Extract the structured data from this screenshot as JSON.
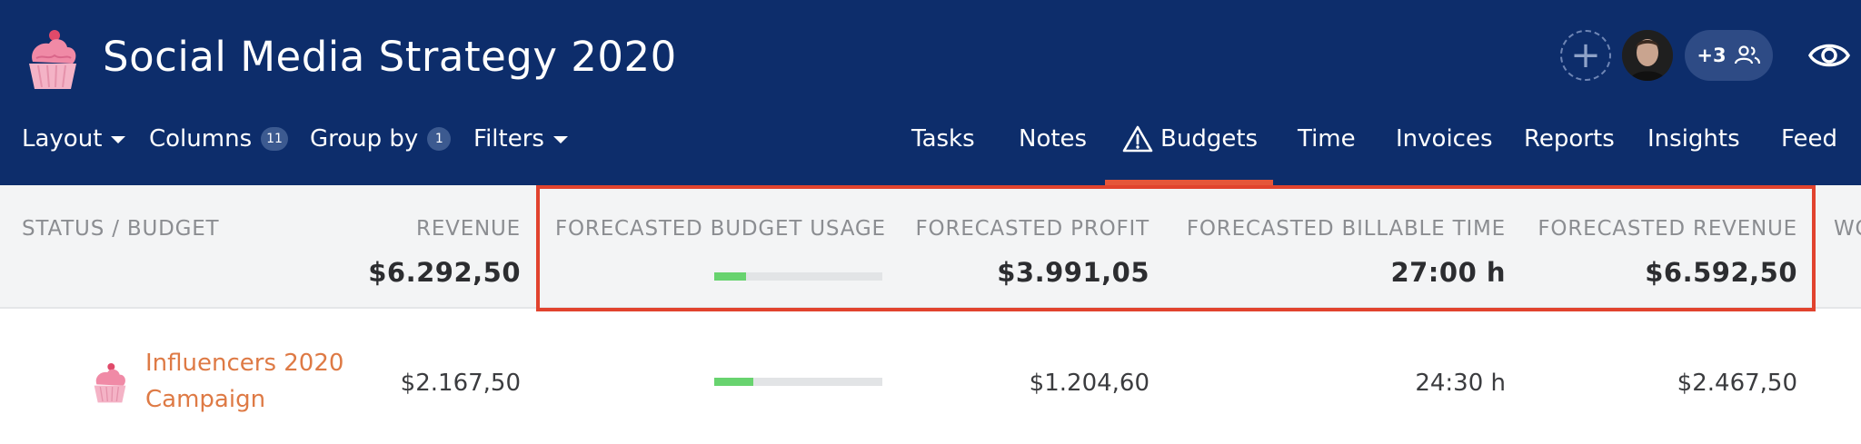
{
  "header": {
    "project_title": "Social Media Strategy 2020",
    "logo_icon": "cupcake-icon",
    "members": {
      "add_icon": "plus-icon",
      "more_count": "+3",
      "more_icon": "people-icon"
    },
    "watch_icon": "eye-icon"
  },
  "toolbar": {
    "layout_label": "Layout",
    "columns_label": "Columns",
    "columns_count": "11",
    "groupby_label": "Group by",
    "groupby_count": "1",
    "filters_label": "Filters"
  },
  "tabs": [
    {
      "label": "Tasks"
    },
    {
      "label": "Notes"
    },
    {
      "label": "Budgets",
      "icon": "warning-triangle-icon",
      "active": true
    },
    {
      "label": "Time"
    },
    {
      "label": "Invoices"
    },
    {
      "label": "Reports"
    },
    {
      "label": "Insights"
    },
    {
      "label": "Feed"
    }
  ],
  "colors": {
    "header_bg": "#0d2d6b",
    "active_tab_underline": "#e5563a",
    "highlight_border": "#e1432e",
    "progress_fill": "#68d36f",
    "row_link": "#de7a45"
  },
  "columns": {
    "status_budget": {
      "label": "STATUS / BUDGET"
    },
    "revenue": {
      "label": "REVENUE",
      "total": "$6.292,50"
    },
    "forecasted_budget_usage": {
      "label": "FORECASTED BUDGET USAGE",
      "total_usage_fraction": 0.19
    },
    "forecasted_profit": {
      "label": "FORECASTED PROFIT",
      "total": "$3.991,05"
    },
    "forecasted_billable_time": {
      "label": "FORECASTED BILLABLE TIME",
      "total": "27:00 h"
    },
    "forecasted_revenue": {
      "label": "FORECASTED REVENUE",
      "total": "$6.592,50"
    },
    "next_partial": {
      "label": "WO"
    }
  },
  "rows": [
    {
      "name": "Influencers 2020 Campaign",
      "icon": "cupcake-icon",
      "revenue": "$2.167,50",
      "forecasted_budget_usage_fraction": 0.23,
      "forecasted_profit": "$1.204,60",
      "forecasted_billable_time": "24:30 h",
      "forecasted_revenue": "$2.467,50"
    }
  ]
}
